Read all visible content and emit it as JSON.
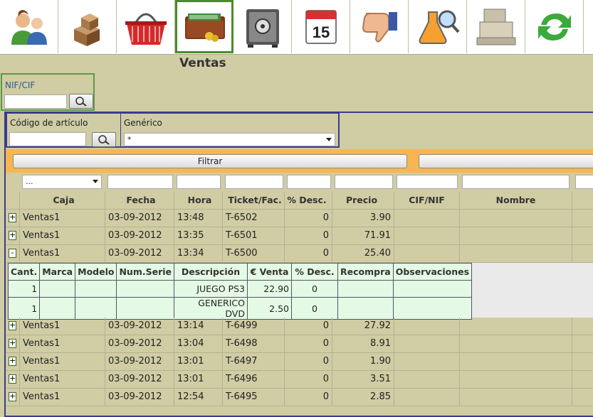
{
  "toolbar": {
    "items": [
      {
        "icon": "users-icon"
      },
      {
        "icon": "boxes-icon"
      },
      {
        "icon": "basket-icon"
      },
      {
        "icon": "wallet-icon",
        "active": true
      },
      {
        "icon": "safe-icon"
      },
      {
        "icon": "calendar-icon",
        "text": "15"
      },
      {
        "icon": "thumbs-down-icon"
      },
      {
        "icon": "flask-magnifier-icon"
      },
      {
        "icon": "cash-register-icon"
      },
      {
        "icon": "refresh-icon"
      }
    ]
  },
  "page_title": "Ventas",
  "nif": {
    "label": "NIF/CIF",
    "value": ""
  },
  "filters": {
    "codigo_label": "Código de artículo",
    "codigo_value": "",
    "generico_label": "Genérico",
    "generico_value": "*",
    "filtrar_label": "Filtrar",
    "caja_filter_value": "..."
  },
  "columns": [
    "Caja",
    "Fecha",
    "Hora",
    "Ticket/Fac.",
    "% Desc.",
    "Precio",
    "CIF/NIF",
    "Nombre"
  ],
  "rows": [
    {
      "exp": "+",
      "caja": "Ventas1",
      "fecha": "03-09-2012",
      "hora": "13:48",
      "ticket": "T-6502",
      "desc": "0",
      "precio": "3.90"
    },
    {
      "exp": "+",
      "caja": "Ventas1",
      "fecha": "03-09-2012",
      "hora": "13:35",
      "ticket": "T-6501",
      "desc": "0",
      "precio": "71.91"
    },
    {
      "exp": "-",
      "caja": "Ventas1",
      "fecha": "03-09-2012",
      "hora": "13:34",
      "ticket": "T-6500",
      "desc": "0",
      "precio": "25.40"
    },
    {
      "exp": "+",
      "caja": "Ventas1",
      "fecha": "03-09-2012",
      "hora": "13:14",
      "ticket": "T-6499",
      "desc": "0",
      "precio": "27.92"
    },
    {
      "exp": "+",
      "caja": "Ventas1",
      "fecha": "03-09-2012",
      "hora": "13:04",
      "ticket": "T-6498",
      "desc": "0",
      "precio": "8.91"
    },
    {
      "exp": "+",
      "caja": "Ventas1",
      "fecha": "03-09-2012",
      "hora": "13:01",
      "ticket": "T-6497",
      "desc": "0",
      "precio": "1.90"
    },
    {
      "exp": "+",
      "caja": "Ventas1",
      "fecha": "03-09-2012",
      "hora": "13:01",
      "ticket": "T-6496",
      "desc": "0",
      "precio": "3.51"
    },
    {
      "exp": "+",
      "caja": "Ventas1",
      "fecha": "03-09-2012",
      "hora": "12:54",
      "ticket": "T-6495",
      "desc": "0",
      "precio": "2.85"
    }
  ],
  "detail": {
    "columns": [
      "Cant.",
      "Marca",
      "Modelo",
      "Num.Serie",
      "Descripción",
      "€ Venta",
      "% Desc.",
      "Recompra",
      "Observaciones"
    ],
    "rows": [
      {
        "cant": "1",
        "marca": "",
        "modelo": "",
        "serie": "",
        "descripcion": "JUEGO PS3",
        "venta": "22.90",
        "desc": "0",
        "recompra": "",
        "obs": ""
      },
      {
        "cant": "1",
        "marca": "",
        "modelo": "",
        "serie": "",
        "descripcion": "GENERICO DVD",
        "venta": "2.50",
        "desc": "0",
        "recompra": "",
        "obs": ""
      }
    ]
  }
}
